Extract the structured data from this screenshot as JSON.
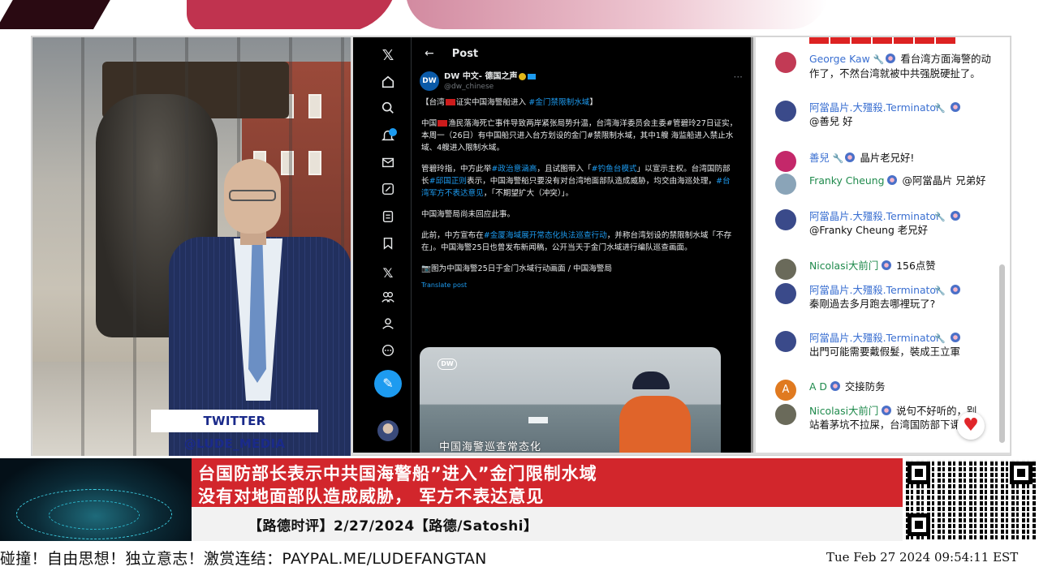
{
  "video": {
    "twitter_tag": "TWITTER @LUDE_MEDIA"
  },
  "tweet": {
    "header_title": "Post",
    "author_name": "DW 中文- 德国之声",
    "author_handle": "@dw_chinese",
    "body": {
      "p1_prefix": "【台湾",
      "p1_mid": "证实中国海警船进入 ",
      "p1_tag": "#金门禁限制水域",
      "p1_suffix": "】",
      "p2_a": "中国",
      "p2_b": "渔民落海死亡事件导致两岸紧张局势升温，台湾海洋委员会主委#管碧玲27日证实，本周一（26日）有中国船只进入台方划设的金门#禁限制水域，其中1艘 海监船进入禁止水域、4艘进入限制水域。",
      "p3_a": "管碧玲指，中方此举",
      "p3_tag1": "#政治意涵高",
      "p3_b": "，且试图带入「",
      "p3_tag2": "#钓鱼台模式",
      "p3_c": "」以宣示主权。台湾国防部长",
      "p3_tag3": "#邱国正则",
      "p3_d": "表示，中国海警船只要没有对台湾地面部队造成威胁，均交由海巡处理，",
      "p3_tag4": "#台湾军方不表达意见",
      "p3_e": "，「不期望扩大（冲突）」。",
      "p4": "中国海警局尚未回应此事。",
      "p5_a": "此前，中方宣布在",
      "p5_tag": "#金厦海域展开常态化执法巡查行动",
      "p5_b": "，并称台湾划设的禁限制水域「不存在」。中国海警25日也曾发布新闻稿，公开当天于金门水域进行编队巡查画面。",
      "p6": "📷图为中国海警25日于金门水域行动画面 / 中国海警局"
    },
    "translate": "Translate post",
    "media_caption": "中国海警巡查常态化",
    "more": "···"
  },
  "chat": {
    "messages": [
      {
        "name": "George Kaw",
        "text": "看台湾方面海警的动作了，不然台湾就被中共强脱硬扯了。",
        "avatar_color": "#c23a55"
      },
      {
        "name": "阿當晶片.大殭殺.Terminator",
        "text": "@善兒 好",
        "avatar_color": "#3a4a8a"
      },
      {
        "name": "善兒",
        "text": "晶片老兄好!",
        "avatar_color": "#c4286a"
      },
      {
        "name": "Franky Cheung",
        "text": "@阿當晶片 兄弟好",
        "avatar_color": "#8aa4b8"
      },
      {
        "name": "阿當晶片.大殭殺.Terminator",
        "text": "@Franky Cheung 老兄好",
        "avatar_color": "#3a4a8a"
      },
      {
        "name": "Nicolasi大前门",
        "text": "156点赞",
        "avatar_color": "#6a6a5a"
      },
      {
        "name": "阿當晶片.大殭殺.Terminator",
        "text": "秦剛過去多月跑去哪裡玩了?",
        "avatar_color": "#3a4a8a"
      },
      {
        "name": "阿當晶片.大殭殺.Terminator",
        "text": "出門可能需要戴假髮，裝成王立軍",
        "avatar_color": "#3a4a8a"
      },
      {
        "name": "A D",
        "text": "交接防务",
        "avatar_color": "#e07a20"
      },
      {
        "name": "Nicolasi大前门",
        "text": "说句不好听的，别站着茅坑不拉屎，台湾国防部下课",
        "avatar_color": "#6a6a5a"
      }
    ],
    "ad_initial": "A"
  },
  "banner": {
    "headline1": "台国防部长表示中共国海警船”进入”金门限制水域",
    "headline2": "没有对地面部队造成威胁， 军方不表达意见",
    "subline": "【路德时评】2/27/2024【路德/Satoshi】"
  },
  "ticker": "碰撞！自由思想！独立意志！激赏连结：PAYPAL.ME/LUDEFANGTAN",
  "clock": "Tue Feb 27 2024 09:54:11 EST"
}
